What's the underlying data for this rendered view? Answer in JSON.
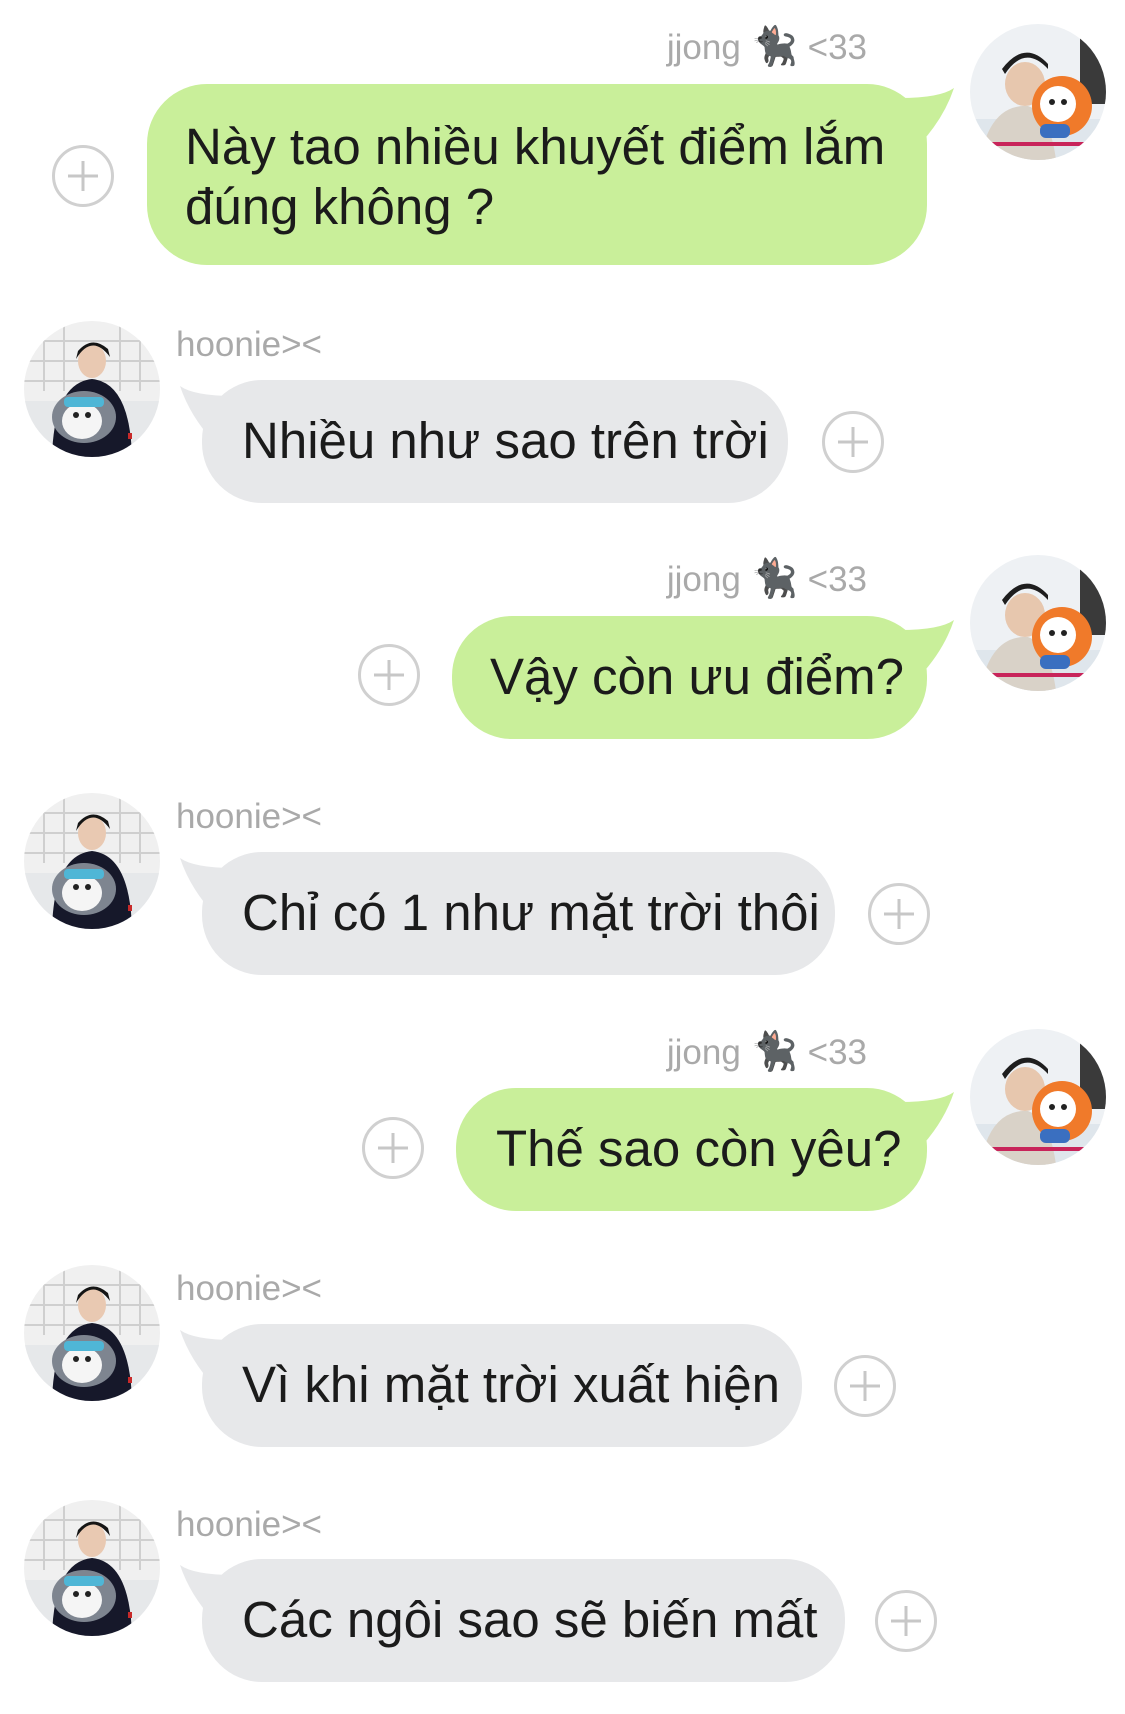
{
  "contacts": {
    "me": {
      "name": "jjong",
      "name_suffix": "<33",
      "emoji": "🐈‍⬛",
      "bubble_color": "#c9ef9a"
    },
    "them": {
      "name": "hoonie><",
      "bubble_color": "#e7e8ea"
    }
  },
  "messages": [
    {
      "sender": "jjong",
      "lines": [
        "Này tao nhiều khuyết điểm lắm",
        "đúng không ?"
      ]
    },
    {
      "sender": "hoonie><",
      "text": "Nhiều như sao trên trời"
    },
    {
      "sender": "jjong",
      "text": "Vậy còn ưu điểm?"
    },
    {
      "sender": "hoonie><",
      "text": "Chỉ có 1 như mặt trời thôi"
    },
    {
      "sender": "jjong",
      "text": "Thế sao còn yêu?"
    },
    {
      "sender": "hoonie><",
      "text": "Vì khi mặt trời xuất hiện"
    },
    {
      "sender": "hoonie><",
      "text": "Các ngôi sao sẽ biến mất"
    }
  ],
  "icons": {
    "add_reaction": "plus-circle-icon",
    "me_avatar": "avatar-photo-with-plush",
    "them_avatar": "avatar-photo-with-penguin-plush"
  }
}
